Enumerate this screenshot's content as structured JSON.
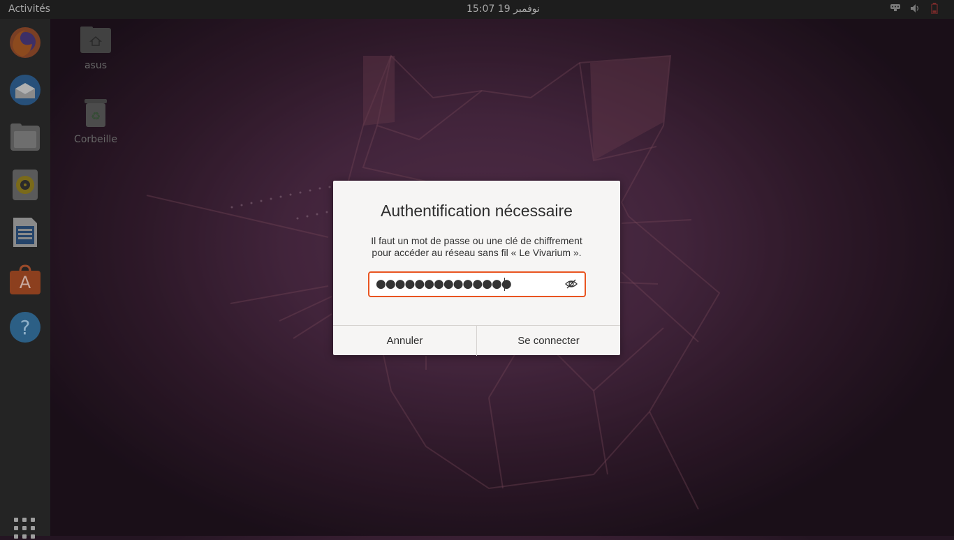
{
  "topbar": {
    "activities_label": "Activités",
    "clock": "15:07  نوفمبر 19"
  },
  "desktop": {
    "icons": [
      {
        "label": "asus"
      },
      {
        "label": "Corbeille"
      }
    ]
  },
  "dock": {
    "apps": [
      "firefox-icon",
      "thunderbird-icon",
      "files-icon",
      "rhythmbox-icon",
      "libreoffice-writer-icon",
      "ubuntu-software-icon",
      "help-icon"
    ]
  },
  "dialog": {
    "title": "Authentification nécessaire",
    "message_line1": "Il faut un mot de passe ou une clé de chiffrement",
    "message_line2": "pour accéder au réseau sans fil « Le Vivarium ».",
    "password_masked": "●●●●●●●●●●●●●●",
    "cancel_label": "Annuler",
    "connect_label": "Se connecter"
  },
  "colors": {
    "accent": "#e95420",
    "topbar": "#1d1d1d",
    "dock": "#242424"
  }
}
